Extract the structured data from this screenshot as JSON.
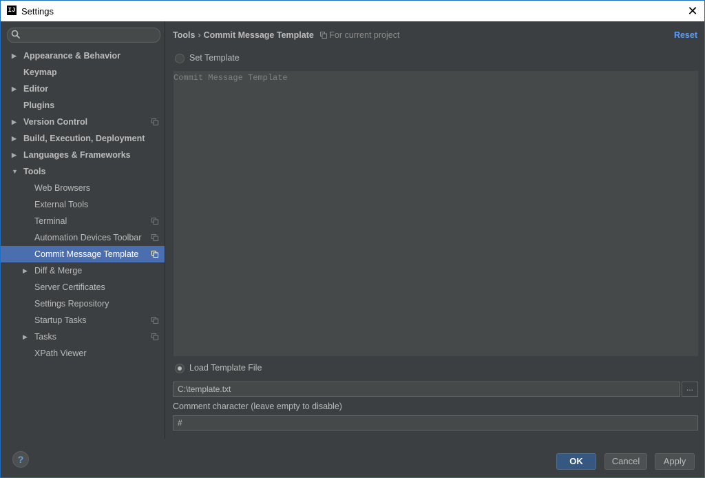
{
  "window": {
    "title": "Settings",
    "app_icon": "IJ"
  },
  "search": {
    "placeholder": "",
    "value": ""
  },
  "sidebar": {
    "items": [
      {
        "label": "Appearance & Behavior",
        "level": 0,
        "arrow": "right",
        "project": false
      },
      {
        "label": "Keymap",
        "level": 0,
        "arrow": "none",
        "project": false
      },
      {
        "label": "Editor",
        "level": 0,
        "arrow": "right",
        "project": false
      },
      {
        "label": "Plugins",
        "level": 0,
        "arrow": "none",
        "project": false
      },
      {
        "label": "Version Control",
        "level": 0,
        "arrow": "right",
        "project": true
      },
      {
        "label": "Build, Execution, Deployment",
        "level": 0,
        "arrow": "right",
        "project": false
      },
      {
        "label": "Languages & Frameworks",
        "level": 0,
        "arrow": "right",
        "project": false
      },
      {
        "label": "Tools",
        "level": 0,
        "arrow": "down",
        "project": false
      },
      {
        "label": "Web Browsers",
        "level": 1,
        "arrow": "none",
        "project": false
      },
      {
        "label": "External Tools",
        "level": 1,
        "arrow": "none",
        "project": false
      },
      {
        "label": "Terminal",
        "level": 1,
        "arrow": "none",
        "project": true
      },
      {
        "label": "Automation Devices Toolbar",
        "level": 1,
        "arrow": "none",
        "project": true
      },
      {
        "label": "Commit Message Template",
        "level": 1,
        "arrow": "none",
        "project": true,
        "selected": true
      },
      {
        "label": "Diff & Merge",
        "level": 1,
        "arrow": "right",
        "project": false
      },
      {
        "label": "Server Certificates",
        "level": 1,
        "arrow": "none",
        "project": false
      },
      {
        "label": "Settings Repository",
        "level": 1,
        "arrow": "none",
        "project": false
      },
      {
        "label": "Startup Tasks",
        "level": 1,
        "arrow": "none",
        "project": true
      },
      {
        "label": "Tasks",
        "level": 1,
        "arrow": "right",
        "project": true
      },
      {
        "label": "XPath Viewer",
        "level": 1,
        "arrow": "none",
        "project": false
      }
    ]
  },
  "main": {
    "breadcrumb": {
      "parent": "Tools",
      "separator": "›",
      "current": "Commit Message Template",
      "scope": "For current project"
    },
    "reset_label": "Reset",
    "set_template": {
      "label": "Set Template",
      "checked": false
    },
    "template_text": "Commit Message Template",
    "load_template": {
      "label": "Load Template File",
      "checked": true
    },
    "file_path": "C:\\template.txt",
    "browse_label": "...",
    "comment_caption": "Comment character (leave empty to disable)",
    "comment_char": "#"
  },
  "footer": {
    "help_label": "?",
    "ok_label": "OK",
    "cancel_label": "Cancel",
    "apply_label": "Apply"
  },
  "colors": {
    "accent": "#589df6",
    "selection": "#4b6eaf",
    "background": "#3c3f41",
    "default_button": "#365880"
  }
}
